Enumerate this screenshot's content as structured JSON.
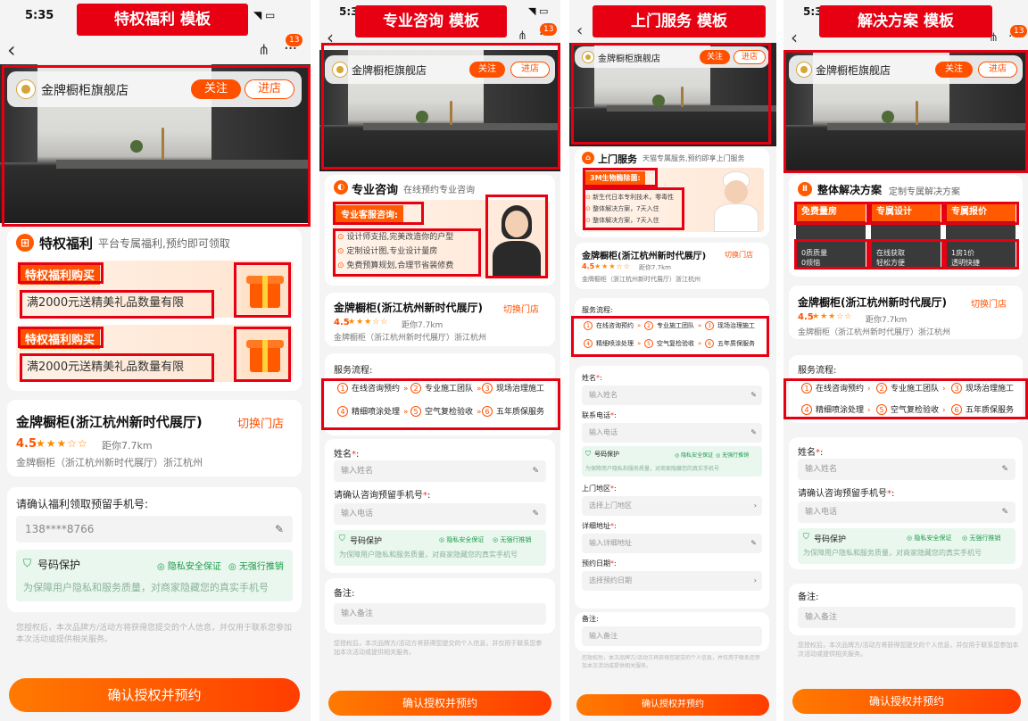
{
  "templates": {
    "t1": "特权福利 模板",
    "t2": "专业咨询 模板",
    "t3": "上门服务 模板",
    "t4": "解决方案 模板"
  },
  "status": {
    "time": "5:35",
    "icons": "◥ ▭",
    "time_short": "5:3"
  },
  "badge": "13",
  "shop": {
    "name": "金牌橱柜旗舰店",
    "follow": "关注",
    "enter": "进店"
  },
  "p1": {
    "title": "特权福利",
    "subtitle": "平台专属福利,预约即可领取",
    "benefits": [
      {
        "tag": "特权福利购买",
        "desc": "满2000元送精美礼品数量有限"
      },
      {
        "tag": "特权福利购买",
        "desc": "满2000元送精美礼品数量有限"
      }
    ],
    "phone_label": "请确认福利领取预留手机号:",
    "phone_value": "138****8766"
  },
  "store": {
    "name": "金牌橱柜(浙江杭州新时代展厅)",
    "switch": "切换门店",
    "rating": "4.5",
    "stars": "★★★☆☆",
    "distance": "距你7.7km",
    "address": "金牌橱柜（浙江杭州新时代展厅）浙江杭州"
  },
  "protect": {
    "title": "号码保护",
    "g1": "隐私安全保证",
    "g2": "无强行推销",
    "desc": "为保障用户隐私和服务质量，对商家隐藏您的真实手机号"
  },
  "disclaimer": "您授权后，本次品牌方/活动方将获得您提交的个人信息，并仅用于联系您参加本次活动或提供相关服务。",
  "cta": "确认授权并预约",
  "p2": {
    "title": "专业咨询",
    "subtitle": "在线预约专业咨询",
    "banner_head": "专业客服咨询:",
    "lines": [
      "设计师支招,完美改造你的户型",
      "定制设计图,专业设计量房",
      "免费预算规划,合理节省装修费"
    ]
  },
  "process": {
    "label": "服务流程:",
    "steps": [
      "在线咨询预约",
      "专业施工团队",
      "现场治理施工",
      "精细喷涂处理",
      "空气复检验收",
      "五年质保服务"
    ],
    "nums": [
      "1",
      "2",
      "3",
      "4",
      "5",
      "6"
    ]
  },
  "form": {
    "name_label": "姓名",
    "name_ph": "输入姓名",
    "phone_label": "请确认咨询预留手机号",
    "phone_ph": "输入电话",
    "contact_label": "联系电话",
    "area_label": "上门地区",
    "area_ph": "选择上门地区",
    "addr_label": "详细地址",
    "addr_ph": "输入详细地址",
    "date_label": "预约日期",
    "date_ph": "选择预约日期",
    "note_label": "备注:",
    "note_ph": "输入备注",
    "req": "*",
    "colon": ":"
  },
  "p3": {
    "title": "上门服务",
    "subtitle": "天猫专属服务,预约即享上门服务",
    "banner_head": "3M生物酶除菌:",
    "lines": [
      "新生代日本专利技术，零毒性",
      "整体解决方案，7天入住",
      "整体解决方案，7天入住"
    ]
  },
  "p4": {
    "title": "整体解决方案",
    "subtitle": "定制专属解决方案",
    "cols": [
      {
        "h": "免费量房",
        "d1": "0质质量",
        "d2": "0烦恼"
      },
      {
        "h": "专属设计",
        "d1": "在线获取",
        "d2": "轻松方便"
      },
      {
        "h": "专属报价",
        "d1": "1房1价",
        "d2": "透明快捷"
      }
    ]
  },
  "colors": {
    "accent": "#ff5000",
    "red": "#e60012",
    "green": "#1b9b4a"
  }
}
